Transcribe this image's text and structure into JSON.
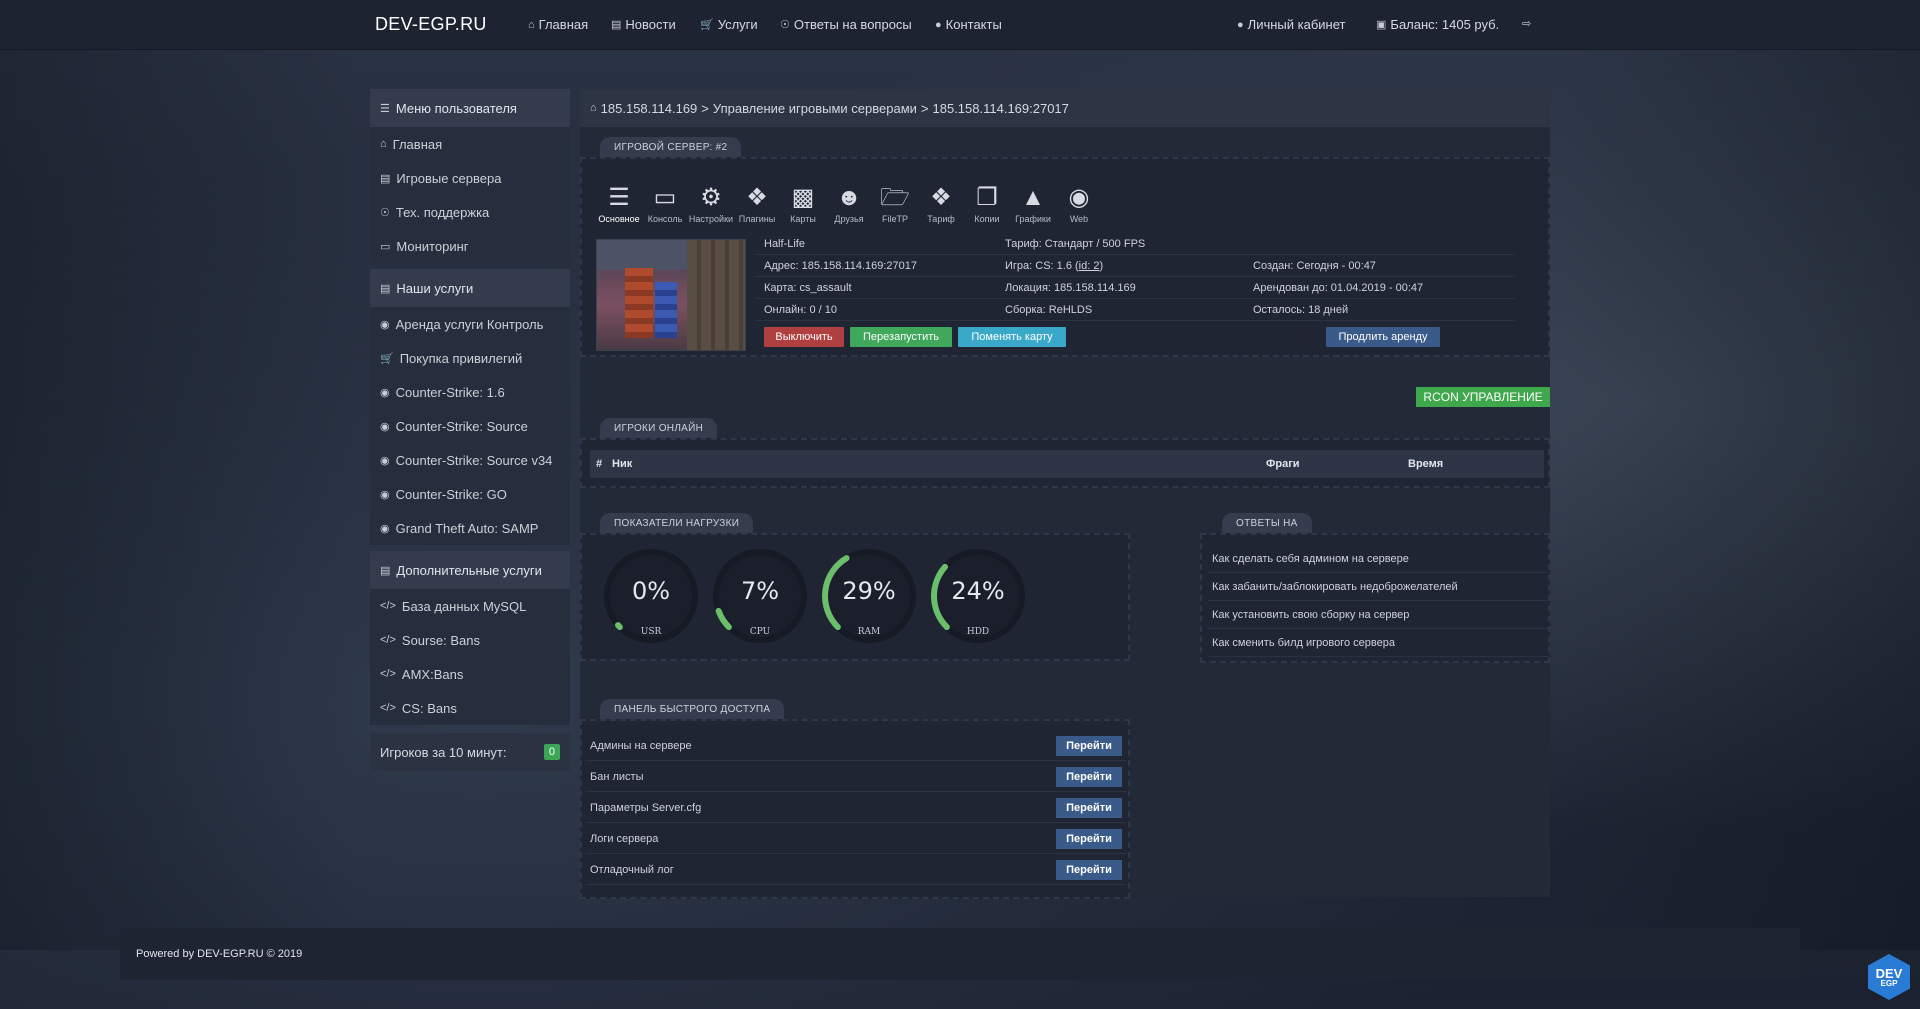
{
  "brand": "DEV-EGP.RU",
  "topnav": {
    "items": [
      {
        "icon": "home-icon",
        "label": "Главная"
      },
      {
        "icon": "newspaper-icon",
        "label": "Новости"
      },
      {
        "icon": "cart-icon",
        "label": "Услуги"
      },
      {
        "icon": "lifebuoy-icon",
        "label": "Ответы на вопросы"
      },
      {
        "icon": "user-icon",
        "label": "Контакты"
      }
    ],
    "account": "Личный кабинет",
    "balance": "Баланс: 1405 руб."
  },
  "sidebar": {
    "user_menu_title": "Меню пользователя",
    "user_menu": [
      "Главная",
      "Игровые сервера",
      "Тех. поддержка",
      "Мониторинг"
    ],
    "services_title": "Наши услуги",
    "services": [
      "Аренда услуги Контроль",
      "Покупка привилегий",
      "Counter-Strike: 1.6",
      "Counter-Strike: Source",
      "Counter-Strike: Source v34",
      "Counter-Strike: GO",
      "Grand Theft Auto: SAMP"
    ],
    "extra_title": "Дополнительные услуги",
    "extra": [
      "База данных MySQL",
      "Sourse: Bans",
      "AMX:Bans",
      "CS: Bans"
    ],
    "players_label": "Игроков за 10 минут:",
    "players_count": "0"
  },
  "breadcrumb": {
    "ip": "185.158.114.169",
    "section": "Управление игровыми серверами",
    "server": "185.158.114.169:27017"
  },
  "server_panel": {
    "tab": "ИГРОВОЙ СЕРВЕР: #2",
    "tools": [
      {
        "icon": "menu-icon",
        "label": "Основное"
      },
      {
        "icon": "monitor-icon",
        "label": "Консоль"
      },
      {
        "icon": "gear-icon",
        "label": "Настройки"
      },
      {
        "icon": "cubes-icon",
        "label": "Плагины"
      },
      {
        "icon": "image-icon",
        "label": "Карты"
      },
      {
        "icon": "user-plus-icon",
        "label": "Друзья"
      },
      {
        "icon": "folder-open-icon",
        "label": "FileTP"
      },
      {
        "icon": "dropbox-icon",
        "label": "Тариф"
      },
      {
        "icon": "copy-icon",
        "label": "Копии"
      },
      {
        "icon": "area-chart-icon",
        "label": "Графики"
      },
      {
        "icon": "globe-icon",
        "label": "Web"
      }
    ],
    "name": "Half-Life",
    "address": "Адрес: 185.158.114.169:27017",
    "map": "Карта: cs_assault",
    "online": "Онлайн: 0 / 10",
    "tariff": "Тариф: Стандарт / 500 FPS",
    "game_prefix": "Игра: CS: 1.6 (",
    "game_link": "id: 2",
    "game_suffix": ")",
    "location": "Локация: 185.158.114.169",
    "build": "Сборка: ReHLDS",
    "created": "Создан: Сегодня - 00:47",
    "rented_until": "Арендован до: 01.04.2019 - 00:47",
    "remaining": "Осталось: 18 дней",
    "btn_off": "Выключить",
    "btn_restart": "Перезапустить",
    "btn_change_map": "Поменять карту",
    "btn_extend": "Продлить аренду"
  },
  "rcon_button": "RCON УПРАВЛЕНИЕ",
  "players": {
    "tab": "ИГРОКИ ОНЛАЙН",
    "col_num": "#",
    "col_nick": "Ник",
    "col_frags": "Фраги",
    "col_time": "Время"
  },
  "load": {
    "tab": "ПОКАЗАТЕЛИ НАГРУЗКИ",
    "accent": "#6cbf6a",
    "gauges": [
      {
        "value": 0,
        "text": "0%",
        "label": "USR"
      },
      {
        "value": 7,
        "text": "7%",
        "label": "CPU"
      },
      {
        "value": 29,
        "text": "29%",
        "label": "RAM"
      },
      {
        "value": 24,
        "text": "24%",
        "label": "HDD"
      }
    ]
  },
  "faq": {
    "tab": "ОТВЕТЫ НА",
    "items": [
      "Как сделать себя админом на сервере",
      "Как забанить/заблокировать недоброжелателей",
      "Как установить свою сборку на сервер",
      "Как сменить билд игрового сервера"
    ]
  },
  "quick": {
    "tab": "ПАНЕЛЬ БЫСТРОГО ДОСТУПА",
    "go_label": "Перейти",
    "items": [
      "Админы на сервере",
      "Бан листы",
      "Параметры Server.cfg",
      "Логи сервера",
      "Отладочный лог"
    ]
  },
  "footer": "Powered by DEV-EGP.RU © 2019",
  "corner_logo": {
    "line1": "DEV",
    "line2": "EGP"
  }
}
